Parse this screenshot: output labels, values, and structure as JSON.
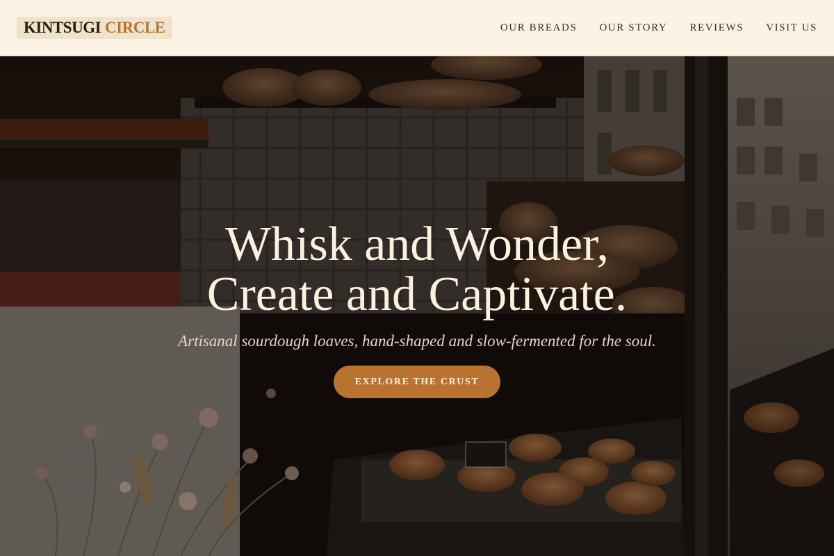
{
  "brand": {
    "name_part1": "KINTSUGI",
    "name_part2": "CIRCLE"
  },
  "nav": {
    "items": [
      {
        "label": "OUR BREADS"
      },
      {
        "label": "OUR STORY"
      },
      {
        "label": "REVIEWS"
      },
      {
        "label": "VISIT US"
      }
    ]
  },
  "hero": {
    "title_line1": "Whisk and Wonder,",
    "title_line2": "Create and Captivate.",
    "subtitle": "Artisanal sourdough loaves, hand-shaped and slow-fermented for the soul.",
    "cta_label": "EXPLORE THE CRUST",
    "background_image": "bakery-window-photo"
  },
  "colors": {
    "header_bg": "#fbf3e3",
    "brand_dark": "#2b1d14",
    "brand_accent": "#b87536",
    "cta_bg": "#b9722f",
    "hero_text": "#fbf1de"
  }
}
